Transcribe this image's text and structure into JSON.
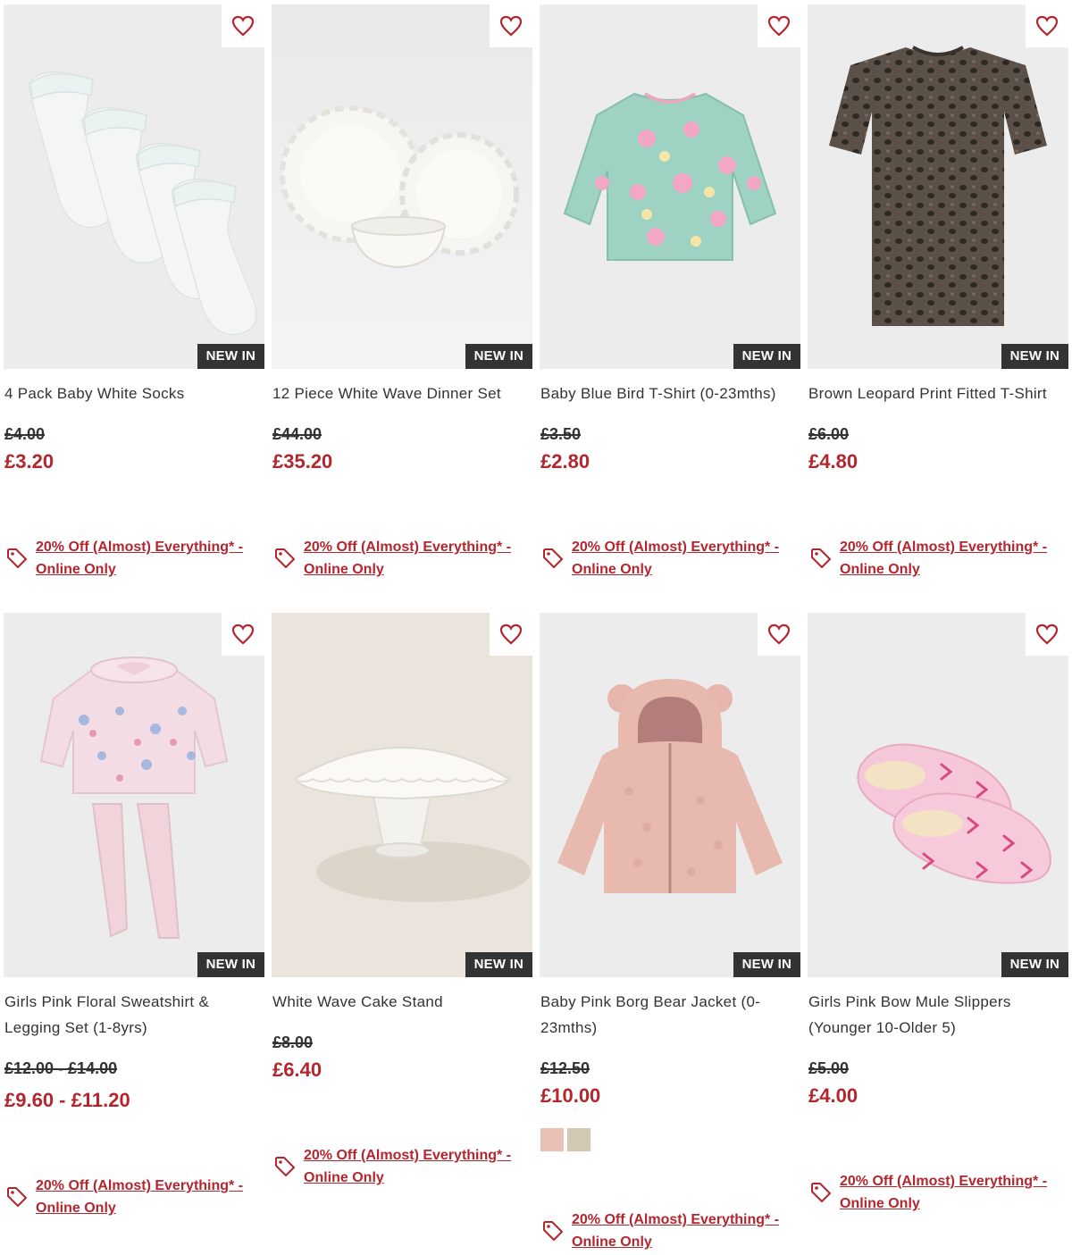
{
  "products": [
    {
      "title": "4 Pack Baby White Socks",
      "badge": "NEW IN",
      "was_price": "£4.00",
      "now_price": "£3.20",
      "promo_line1": "20% Off (Almost) Everything* -",
      "promo_line2": "Online Only"
    },
    {
      "title": "12 Piece White Wave Dinner Set",
      "badge": "NEW IN",
      "was_price": "£44.00",
      "now_price": "£35.20",
      "promo_line1": "20% Off (Almost) Everything* -",
      "promo_line2": "Online Only"
    },
    {
      "title": "Baby Blue Bird T-Shirt (0-23mths)",
      "badge": "NEW IN",
      "was_price": "£3.50",
      "now_price": "£2.80",
      "promo_line1": "20% Off (Almost) Everything* -",
      "promo_line2": "Online Only"
    },
    {
      "title": "Brown Leopard Print Fitted T-Shirt",
      "badge": "NEW IN",
      "was_price": "£6.00",
      "now_price": "£4.80",
      "promo_line1": "20% Off (Almost) Everything* -",
      "promo_line2": "Online Only"
    },
    {
      "title": "Girls Pink Floral Sweatshirt & Legging Set (1-8yrs)",
      "badge": "NEW IN",
      "was_price": "£12.00 - £14.00",
      "now_price": "£9.60 - £11.20",
      "promo_line1": "20% Off (Almost) Everything* -",
      "promo_line2": "Online Only"
    },
    {
      "title": "White Wave Cake Stand",
      "badge": "NEW IN",
      "was_price": "£8.00",
      "now_price": "£6.40",
      "promo_line1": "20% Off (Almost) Everything* -",
      "promo_line2": "Online Only"
    },
    {
      "title": "Baby Pink Borg Bear Jacket (0-23mths)",
      "badge": "NEW IN",
      "was_price": "£12.50",
      "now_price": "£10.00",
      "swatches": [
        "#e8c0b6",
        "#d3c9b3"
      ],
      "promo_line1": "20% Off (Almost) Everything* -",
      "promo_line2": "Online Only"
    },
    {
      "title": "Girls Pink Bow Mule Slippers (Younger 10-Older 5)",
      "badge": "NEW IN",
      "was_price": "£5.00",
      "now_price": "£4.00",
      "promo_line1": "20% Off (Almost) Everything* -",
      "promo_line2": "Online Only"
    }
  ],
  "colors": {
    "accent": "#b3262e",
    "badge_bg": "#333333",
    "image_bg": "#ececec"
  }
}
